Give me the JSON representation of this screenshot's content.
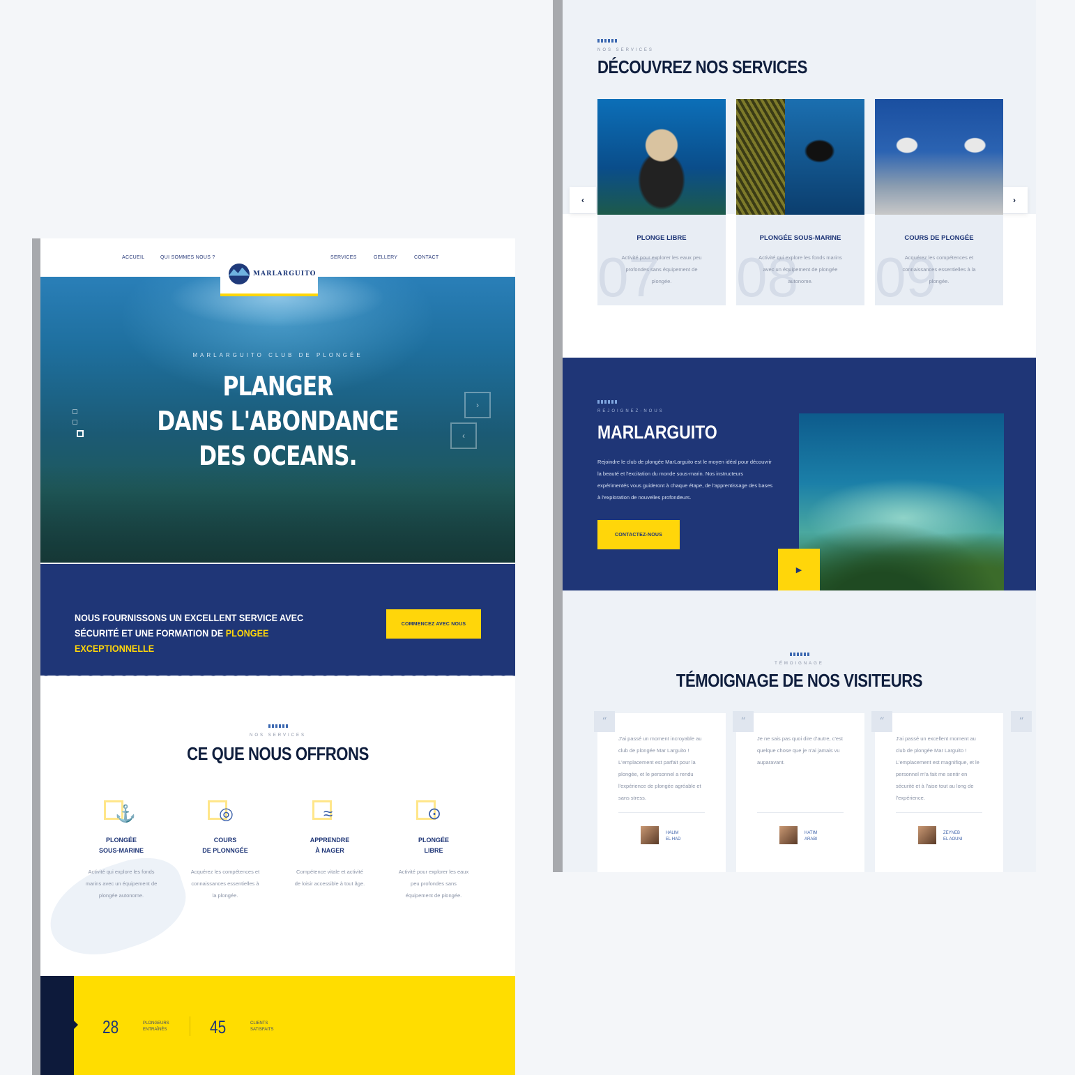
{
  "left": {
    "nav": [
      "ACCUEIL",
      "QUI SOMMES NOUS ?",
      "SERVICES",
      "GELLERY",
      "CONTACT"
    ],
    "logo": "MARLARGUITO",
    "hero": {
      "kicker": "MARLARGUITO CLUB DE PLONGÉE",
      "title_lines": [
        "PLANGER",
        "DANS L'ABONDANCE",
        "DES OCEANS."
      ]
    },
    "band": {
      "text_main": "NOUS FOURNISSONS UN EXCELLENT SERVICE AVEC SÉCURITÉ ET UNE FORMATION DE ",
      "text_highlight": "PLONGEE EXCEPTIONNELLE",
      "button": "COMMENCEZ AVEC NOUS"
    },
    "offer": {
      "kicker": "NOS SERVICES",
      "title": "CE QUE NOUS OFFRONS",
      "items": [
        {
          "title1": "PLONGÉE",
          "title2": "SOUS-MARINE",
          "text": "Activité qui explore les fonds marins avec un équipement de plongée autonome.",
          "icon": "diver-icon"
        },
        {
          "title1": "COURS",
          "title2": "DE PLONNGÉE",
          "text": "Acquérez les compétences et connaissances essentielles à la plongée.",
          "icon": "diving-helmet-icon"
        },
        {
          "title1": "APPRENDRE",
          "title2": "À NAGER",
          "text": "Compétence vitale et activité de loisir accessible à tout âge.",
          "icon": "swimmer-icon"
        },
        {
          "title1": "PLONGÉE",
          "title2": "LIBRE",
          "text": "Activité pour explorer les eaux peu profondes sans équipement de plongée.",
          "icon": "snorkel-mask-icon"
        }
      ]
    },
    "stats": [
      {
        "num": "28",
        "label1": "PLONGEURS",
        "label2": "ENTRAÎNÉS"
      },
      {
        "num": "45",
        "label1": "CLIENTS",
        "label2": "SATISFAITS"
      }
    ]
  },
  "right": {
    "services": {
      "kicker": "NOS SERVICES",
      "title": "DÉCOUVREZ NOS SERVICES",
      "items": [
        {
          "num": "07",
          "title": "PLONGE LIBRE",
          "text": "Activité pour explorer les eaux peu profondes sans équipement de plongée."
        },
        {
          "num": "08",
          "title": "PLONGÉE SOUS-MARINE",
          "text": "Activité qui explore les fonds marins avec un équipement de plongée autonome."
        },
        {
          "num": "09",
          "title": "COURS DE PLONGÉE",
          "text": "Acquérez les compétences et connaissances essentielles à la plongée."
        }
      ]
    },
    "join": {
      "kicker": "REJOIGNEZ-NOUS",
      "title": "MARLARGUITO",
      "text": "Rejoindre le club de plongée MarLarguito est le moyen idéal pour découvrir la beauté et l'excitation du monde sous-marin. Nos instructeurs expérimentés vous guideront à chaque étape, de l'apprentissage des bases à l'exploration de nouvelles profondeurs.",
      "button": "CONTACTEZ-NOUS"
    },
    "testimonials": {
      "kicker": "TÉMOIGNAGE",
      "title": "TÉMOIGNAGE DE NOS VISITEURS",
      "items": [
        {
          "text": "J'ai passé un moment incroyable au club de plongée Mar Larguito ! L'emplacement est parfait pour la plongée, et le personnel a rendu l'expérience de plongée agréable et sans stress.",
          "name1": "HALIM",
          "name2": "EL HAD"
        },
        {
          "text": "Je ne sais pas quoi dire d'autre, c'est quelque chose que je n'ai jamais vu auparavant.",
          "name1": "HATIM",
          "name2": "ARABI"
        },
        {
          "text": "J'ai passé un excellent moment au club de plongée Mar Larguito ! L'emplacement est magnifique, et le personnel m'a fait me sentir en sécurité et à l'aise tout au long de l'expérience.",
          "name1": "ZEYNEB",
          "name2": "EL AOUNI"
        }
      ]
    }
  },
  "colors": {
    "navy": "#1f3677",
    "yellow": "#ffd60a",
    "dark": "#0d1a3b"
  }
}
